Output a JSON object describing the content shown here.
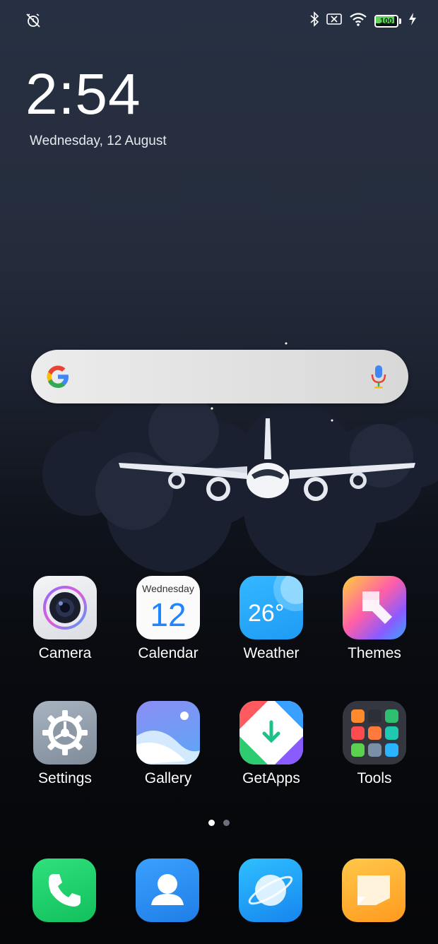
{
  "status_bar": {
    "left_icon": "alarm-off-icon",
    "right_icons": [
      "bluetooth-icon",
      "no-sim-icon",
      "wifi-icon",
      "battery-icon",
      "charging-icon"
    ],
    "battery_level": "100",
    "battery_fraction": 1.0,
    "battery_color": "#5fd35a"
  },
  "lock_clock": {
    "time": "2:54",
    "date": "Wednesday, 12 August"
  },
  "search": {
    "provider_icon": "google-icon",
    "mic_icon": "mic-icon"
  },
  "apps": [
    {
      "label": "Camera",
      "icon": "camera-icon"
    },
    {
      "label": "Calendar",
      "icon": "calendar-icon",
      "day_name": "Wednesday",
      "day_number": "12"
    },
    {
      "label": "Weather",
      "icon": "weather-icon",
      "temperature": "26°"
    },
    {
      "label": "Themes",
      "icon": "themes-brush-icon"
    },
    {
      "label": "Settings",
      "icon": "gear-icon"
    },
    {
      "label": "Gallery",
      "icon": "gallery-icon"
    },
    {
      "label": "GetApps",
      "icon": "getapps-icon"
    },
    {
      "label": "Tools",
      "icon": "folder-icon"
    }
  ],
  "pager": {
    "pages": 2,
    "current": 1
  },
  "dock": [
    {
      "icon": "phone-icon",
      "color": "#1fd06a"
    },
    {
      "icon": "contacts-icon",
      "color": "#2d8cf0"
    },
    {
      "icon": "browser-icon",
      "color": "#1aa8f5"
    },
    {
      "icon": "notes-icon",
      "color": "#ffae2b"
    }
  ]
}
